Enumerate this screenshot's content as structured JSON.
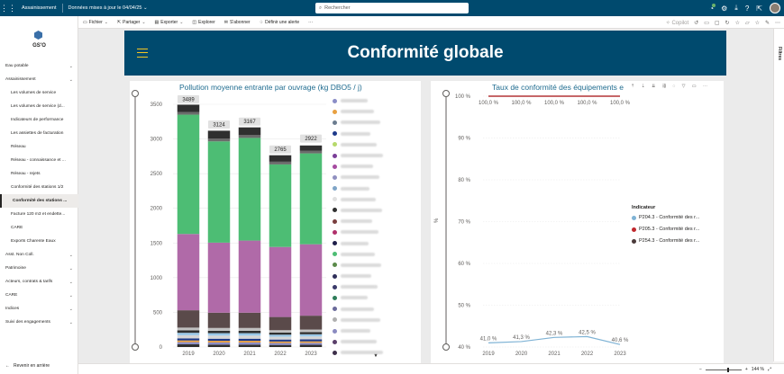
{
  "topbar": {
    "app_name": "Assainissement",
    "data_update": "Données mises à jour le 04/04/25",
    "search_placeholder": "Rechercher"
  },
  "sidebar": {
    "org": "GS'O",
    "items": [
      {
        "label": "Eau potable",
        "level": 0,
        "chevron": true
      },
      {
        "label": "Assainissement",
        "level": 0,
        "chevron": true
      },
      {
        "label": "Les volumes de service",
        "level": 1
      },
      {
        "label": "Les volumes de service (d...",
        "level": 1
      },
      {
        "label": "Indicateurs de performance",
        "level": 1
      },
      {
        "label": "Les assiettes de facturation",
        "level": 1
      },
      {
        "label": "Réseau",
        "level": 1
      },
      {
        "label": "Réseau - connaissance et ...",
        "level": 1
      },
      {
        "label": "Réseau - rejets",
        "level": 1
      },
      {
        "label": "Conformité des stations 1/2",
        "level": 1
      },
      {
        "label": "Conformité des stations ...",
        "level": 1,
        "active": true
      },
      {
        "label": "Facture 120 m3 et endette...",
        "level": 1
      },
      {
        "label": "CARE",
        "level": 1
      },
      {
        "label": "Exports Charente Eaux",
        "level": 1
      },
      {
        "label": "Asst. Non Coll.",
        "level": 0,
        "chevron": true
      },
      {
        "label": "Patrimoine",
        "level": 0,
        "chevron": true
      },
      {
        "label": "Acteurs, contrats & tarifs",
        "level": 0,
        "chevron": true
      },
      {
        "label": "CARE",
        "level": 0,
        "chevron": true
      },
      {
        "label": "Indices",
        "level": 0,
        "chevron": true
      },
      {
        "label": "Suivi des engagements",
        "level": 0,
        "chevron": true
      }
    ],
    "back_label": "Revenir en arrière"
  },
  "toolbar": {
    "items": [
      "Fichier",
      "Partager",
      "Exporter",
      "Explorer",
      "S'abonner",
      "Définir une alerte",
      "···"
    ],
    "copilot": "Copilot"
  },
  "filters_label": "Filtres",
  "banner": {
    "title": "Conformité globale"
  },
  "footer": {
    "zoom": "144 %"
  },
  "chart_data": [
    {
      "type": "bar",
      "title": "Pollution moyenne entrante par ouvrage (kg DBO5 / j)",
      "categories": [
        "2019",
        "2020",
        "2021",
        "2022",
        "2023"
      ],
      "totals": [
        3489,
        3124,
        3167,
        2765,
        2922
      ],
      "ylim": [
        0,
        3500
      ],
      "yticks": [
        0,
        500,
        1000,
        1500,
        2000,
        2500,
        3000,
        3500
      ],
      "stacked": true,
      "series": [
        {
          "color": "#2f2f2f",
          "values": [
            40,
            35,
            35,
            30,
            32
          ]
        },
        {
          "color": "#8a8dc7",
          "values": [
            30,
            30,
            30,
            28,
            28
          ]
        },
        {
          "color": "#e8a040",
          "values": [
            25,
            25,
            25,
            22,
            22
          ]
        },
        {
          "color": "#1e3a8a",
          "values": [
            30,
            30,
            30,
            28,
            28
          ]
        },
        {
          "color": "#d6d6d6",
          "values": [
            45,
            45,
            45,
            40,
            42
          ]
        },
        {
          "color": "#9ac8e8",
          "values": [
            35,
            35,
            35,
            30,
            32
          ]
        },
        {
          "color": "#2f2f2f",
          "values": [
            35,
            35,
            35,
            30,
            32
          ]
        },
        {
          "color": "#c0c0c0",
          "values": [
            40,
            40,
            40,
            35,
            36
          ]
        },
        {
          "color": "#5a4a4a",
          "values": [
            250,
            220,
            220,
            190,
            200
          ]
        },
        {
          "color": "#b06aa8",
          "values": [
            1100,
            1010,
            1040,
            1010,
            1030
          ]
        },
        {
          "color": "#4dbd74",
          "values": [
            1720,
            1460,
            1480,
            1190,
            1310
          ]
        },
        {
          "color": "#6b6b6b",
          "values": [
            40,
            39,
            40,
            39,
            40
          ]
        },
        {
          "color": "#2f2f2f",
          "values": [
            104,
            115,
            112,
            93,
            74
          ]
        }
      ],
      "legend_colors": [
        "#8a8dc7",
        "#e8a040",
        "#6b7c8f",
        "#1e3a8a",
        "#b6d96b",
        "#7a3e98",
        "#a64ba0",
        "#9090c0",
        "#7fa5c7",
        "#e0e0e0",
        "#2f2f2f",
        "#7a3f3f",
        "#b0306b",
        "#1f1f4a",
        "#4dbd74",
        "#5a8a4a",
        "#2f2f5a",
        "#3a3a6a",
        "#2e7d5a",
        "#6a6a9a",
        "#b0b0b0",
        "#8a8ac0",
        "#5a3f6a",
        "#3d2f4a"
      ]
    },
    {
      "type": "line",
      "title": "Taux de conformité des équipements e",
      "ylabel": "%",
      "categories": [
        "2019",
        "2020",
        "2021",
        "2022",
        "2023"
      ],
      "ylim": [
        40,
        100
      ],
      "yticks": [
        "40 %",
        "50 %",
        "60 %",
        "70 %",
        "80 %",
        "90 %",
        "100 %"
      ],
      "series": [
        {
          "name": "P204.3 - Conformité des r...",
          "color": "#7fb3d5",
          "values": [
            41.0,
            41.3,
            42.3,
            42.5,
            40.6
          ],
          "labels": [
            "41,0 %",
            "41,3 %",
            "42,3 %",
            "42,5 %",
            "40,6 %"
          ]
        },
        {
          "name": "P205.3 - Conformité des r...",
          "color": "#c0282d",
          "values": [
            100,
            100,
            100,
            100,
            100
          ],
          "labels": [
            "100,0 %",
            "100,0 %",
            "100,0 %",
            "100,0 %",
            "100,0 %"
          ]
        },
        {
          "name": "P254.3 - Conformité des r...",
          "color": "#4a3a3a",
          "values": [
            100,
            100,
            100,
            100,
            100
          ]
        }
      ],
      "legend_title": "Indicateur"
    }
  ]
}
